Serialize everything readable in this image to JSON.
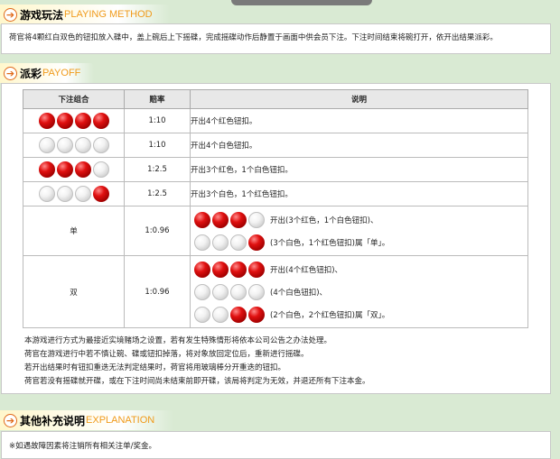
{
  "sections": {
    "rules": {
      "title": "游戏玩法",
      "title_en": "PLAYING METHOD",
      "text": "荷官将4颗红白双色的钮扣放入碟中，盖上碗后上下摇碟，完成摇碟动作后静置于画面中供会员下注。下注时间结束将碗打开，依开出结果派彩。"
    },
    "payoff": {
      "title": "派彩",
      "title_en": "PAYOFF"
    },
    "other": {
      "title": "其他补充说明",
      "title_en": "EXPLANATION",
      "text": "※如遇故障因素将注销所有相关注单/奖金。"
    }
  },
  "table": {
    "headers": [
      "下注组合",
      "赔率",
      "说明"
    ],
    "rows": [
      {
        "balls": [
          "red",
          "red",
          "red",
          "red"
        ],
        "odds": "1:10",
        "desc": "开出4个红色钮扣。"
      },
      {
        "balls": [
          "white",
          "white",
          "white",
          "white"
        ],
        "odds": "1:10",
        "desc": "开出4个白色钮扣。"
      },
      {
        "balls": [
          "red",
          "red",
          "red",
          "white"
        ],
        "odds": "1:2.5",
        "desc": "开出3个红色，1个白色钮扣。"
      },
      {
        "balls": [
          "white",
          "white",
          "white",
          "red"
        ],
        "odds": "1:2.5",
        "desc": "开出3个白色，1个红色钮扣。"
      }
    ],
    "odd": {
      "label": "单",
      "odds": "1:0.96",
      "lines": [
        {
          "balls": [
            "red",
            "red",
            "red",
            "white"
          ],
          "text": "开出(3个红色，1个白色钮扣)、"
        },
        {
          "balls": [
            "white",
            "white",
            "white",
            "red"
          ],
          "text": "(3个白色，1个红色钮扣)属「单」。"
        }
      ]
    },
    "even": {
      "label": "双",
      "odds": "1:0.96",
      "lines": [
        {
          "balls": [
            "red",
            "red",
            "red",
            "red"
          ],
          "text": "开出(4个红色钮扣)、"
        },
        {
          "balls": [
            "white",
            "white",
            "white",
            "white"
          ],
          "text": "(4个白色钮扣)、"
        },
        {
          "balls": [
            "white",
            "white",
            "red",
            "red"
          ],
          "text": "(2个白色，2个红色钮扣)属「双」。"
        }
      ]
    }
  },
  "notes": [
    "本游戏进行方式为最接近实境赌场之设置，若有发生特殊情形将依本公司公告之办法处理。",
    "荷官在游戏进行中若不慎让碗、碟或钮扣掉落，将对象放回定位后，重新进行摇碟。",
    "若开出结果时有钮扣重迭无法判定结果时，荷官将用玻璃棒分开重迭的钮扣。",
    "荷官若没有摇碟就开碟，或在下注时间尚未结束前即开碟，该局将判定为无效，并退还所有下注本金。"
  ],
  "colors": {
    "accent": "#e06a1a",
    "title_en": "#f09a1a",
    "bg": "#d9ead3",
    "red_ball": "#e01010"
  }
}
